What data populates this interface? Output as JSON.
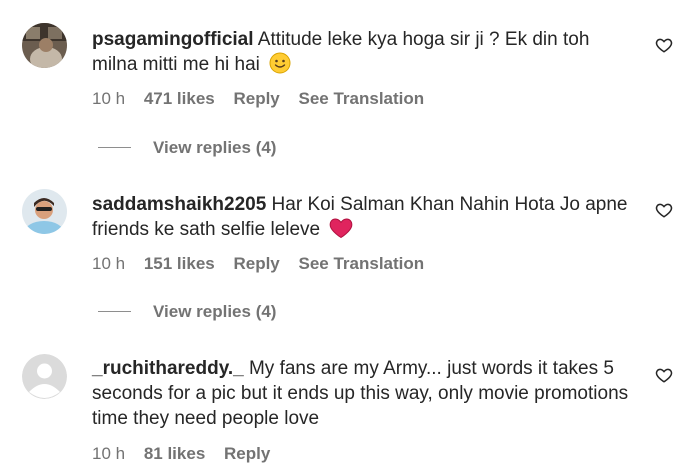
{
  "comments": [
    {
      "username": "psagamingofficial",
      "text": "Attitude leke kya hoga sir ji ? Ek din toh milna mitti me hi hai",
      "emoji": "slightly-smiling-face",
      "time": "10 h",
      "likes": "471 likes",
      "reply": "Reply",
      "translate": "See Translation",
      "view_replies": "View replies (4)"
    },
    {
      "username": "saddamshaikh2205",
      "text": "Har Koi Salman Khan Nahin Hota Jo apne friends ke sath selfie leleve",
      "emoji": "red-heart",
      "time": "10 h",
      "likes": "151 likes",
      "reply": "Reply",
      "translate": "See Translation",
      "view_replies": "View replies (4)"
    },
    {
      "username": "_ruchithareddy._",
      "text": "My fans are my Army... just words it takes 5 seconds for a pic but it ends up this way, only movie promotions time they need people love",
      "time": "10 h",
      "likes": "81 likes",
      "reply": "Reply"
    }
  ],
  "icons": {
    "like": "heart-outline-icon",
    "default_avatar": "default-avatar-icon"
  },
  "colors": {
    "text": "#262626",
    "secondary": "#737373",
    "heart_red": "#e0245e"
  }
}
